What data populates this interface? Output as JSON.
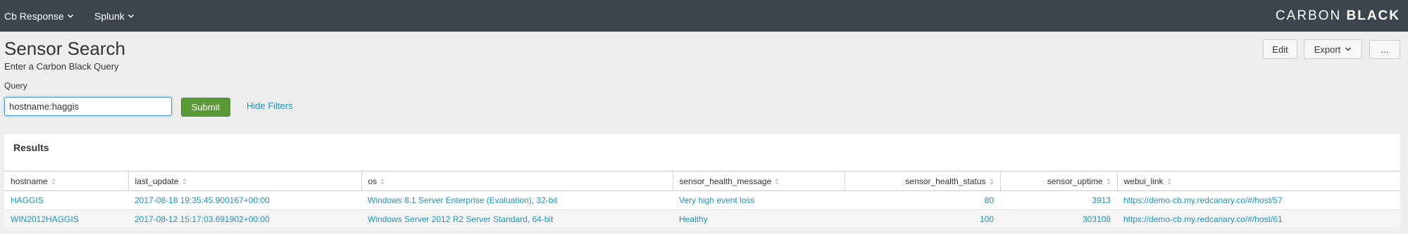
{
  "nav": {
    "menus": [
      {
        "label": "Cb Response"
      },
      {
        "label": "Splunk"
      }
    ],
    "brand_light": "CARBON",
    "brand_bold": "BLACK"
  },
  "header": {
    "title": "Sensor Search",
    "subtitle": "Enter a Carbon Black Query",
    "buttons": {
      "edit": "Edit",
      "export": "Export",
      "more": "..."
    }
  },
  "query": {
    "label": "Query",
    "value": "hostname:haggis",
    "submit_label": "Submit",
    "hide_filters_label": "Hide Filters"
  },
  "results": {
    "title": "Results",
    "columns": [
      {
        "label": "hostname"
      },
      {
        "label": "last_update"
      },
      {
        "label": "os"
      },
      {
        "label": "sensor_health_message"
      },
      {
        "label": "sensor_health_status"
      },
      {
        "label": "sensor_uptime"
      },
      {
        "label": "webui_link"
      }
    ],
    "rows": [
      {
        "hostname": "HAGGIS",
        "last_update": "2017-08-18 19:35:45.900167+00:00",
        "os": "Windows 8.1 Server Enterprise (Evaluation), 32-bit",
        "sensor_health_message": "Very high event loss",
        "sensor_health_status": "80",
        "sensor_uptime": "3913",
        "webui_link": "https://demo-cb.my.redcanary.co/#/host/57"
      },
      {
        "hostname": "WIN2012HAGGIS",
        "last_update": "2017-08-12 15:17:03.691902+00:00",
        "os": "Windows Server 2012 R2 Server Standard, 64-bit",
        "sensor_health_message": "Healthy",
        "sensor_health_status": "100",
        "sensor_uptime": "303108",
        "webui_link": "https://demo-cb.my.redcanary.co/#/host/61"
      }
    ]
  },
  "colors": {
    "topbar": "#3c444d",
    "background": "#eeeeee",
    "link": "#1e93c6",
    "submit": "#5a9a36"
  }
}
